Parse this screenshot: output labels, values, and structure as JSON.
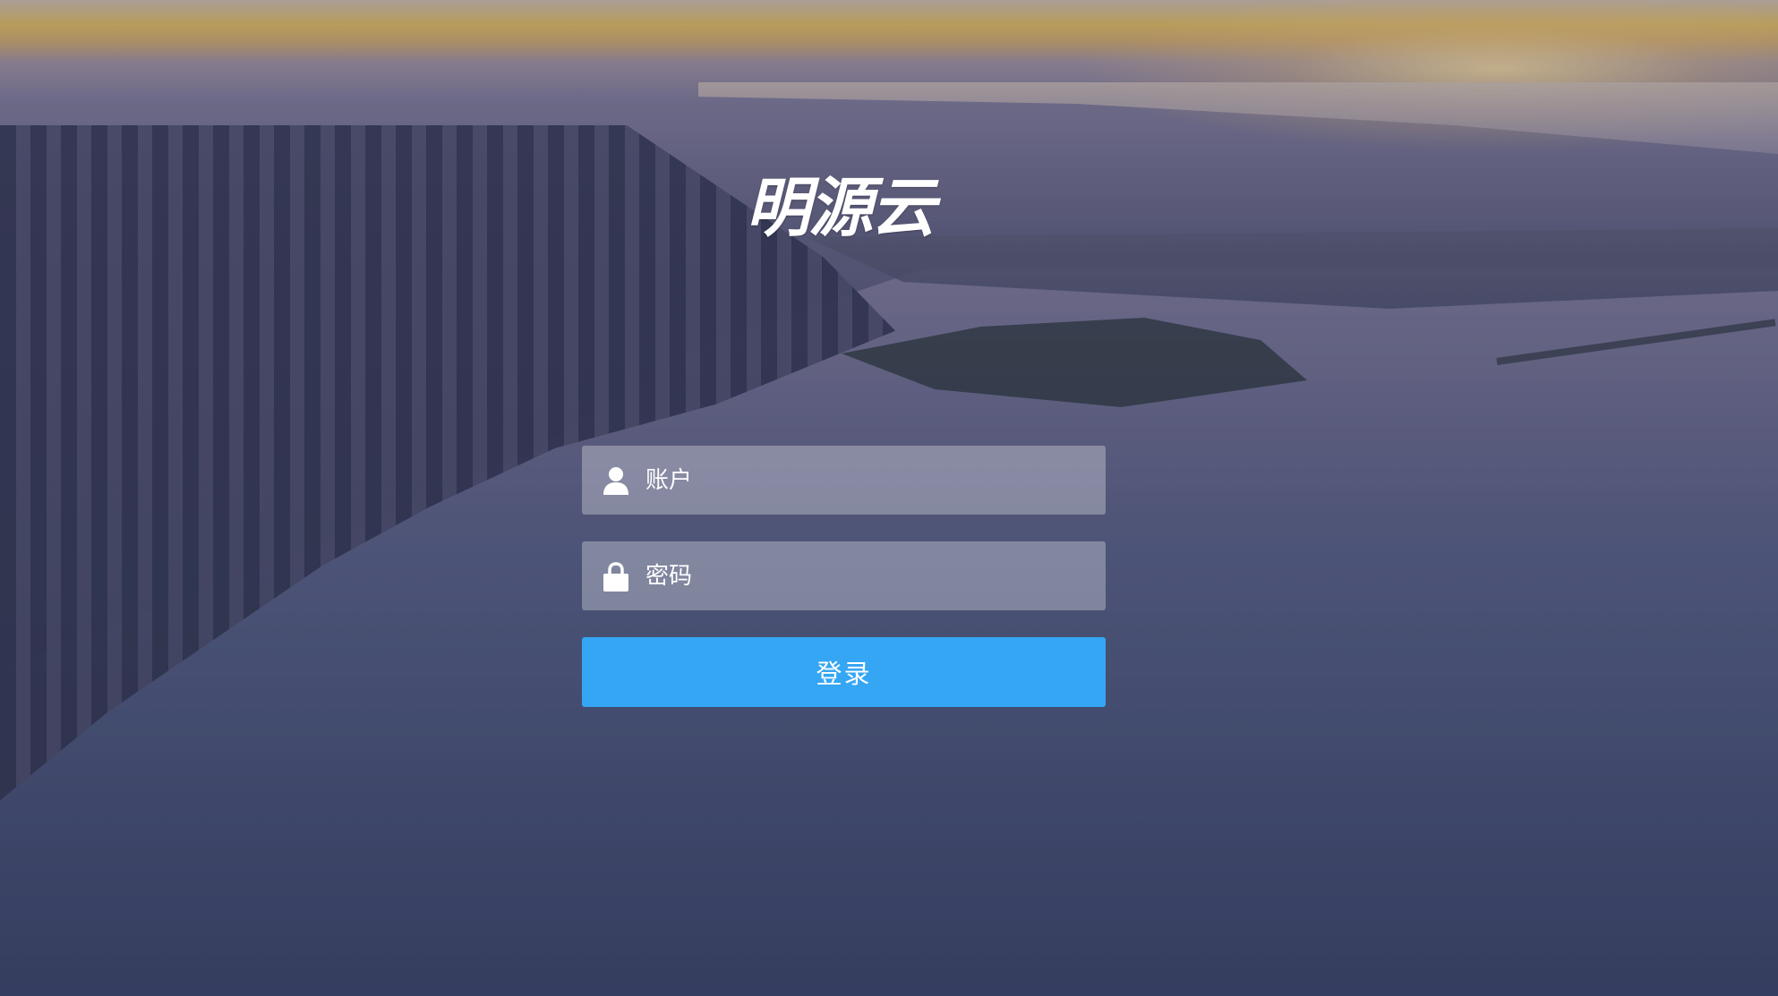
{
  "brand": {
    "logo_text": "明源云"
  },
  "login_form": {
    "account": {
      "icon": "user-icon",
      "placeholder": "账户",
      "value": ""
    },
    "password": {
      "icon": "lock-icon",
      "placeholder": "密码",
      "value": ""
    },
    "submit_label": "登录"
  },
  "colors": {
    "button_primary": "#35a6f4",
    "field_background": "rgba(255,255,255,0.30)",
    "text": "#ffffff"
  }
}
